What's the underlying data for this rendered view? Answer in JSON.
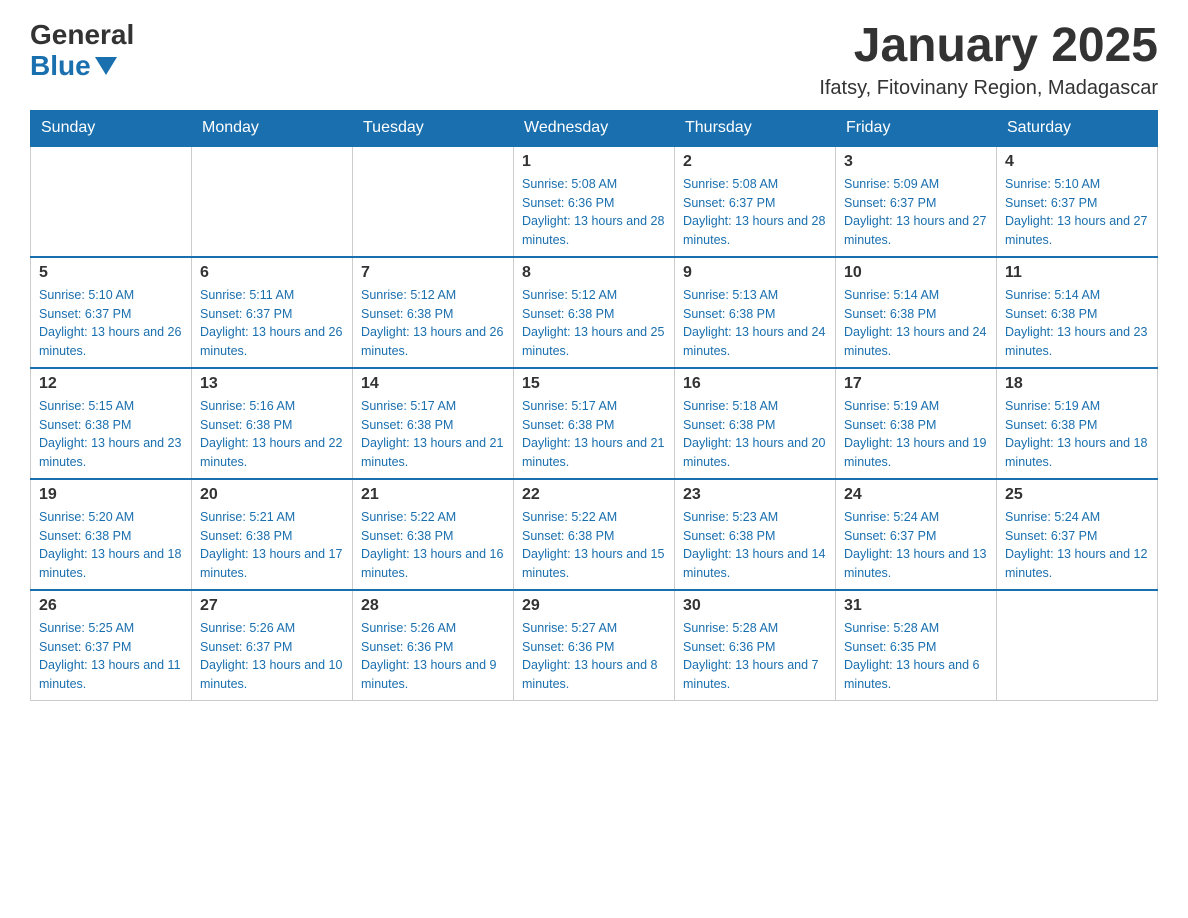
{
  "header": {
    "logo": {
      "text1": "General",
      "text2": "Blue"
    },
    "title": "January 2025",
    "subtitle": "Ifatsy, Fitovinany Region, Madagascar"
  },
  "days_of_week": [
    "Sunday",
    "Monday",
    "Tuesday",
    "Wednesday",
    "Thursday",
    "Friday",
    "Saturday"
  ],
  "weeks": [
    [
      {
        "day": "",
        "info": ""
      },
      {
        "day": "",
        "info": ""
      },
      {
        "day": "",
        "info": ""
      },
      {
        "day": "1",
        "info": "Sunrise: 5:08 AM\nSunset: 6:36 PM\nDaylight: 13 hours and 28 minutes."
      },
      {
        "day": "2",
        "info": "Sunrise: 5:08 AM\nSunset: 6:37 PM\nDaylight: 13 hours and 28 minutes."
      },
      {
        "day": "3",
        "info": "Sunrise: 5:09 AM\nSunset: 6:37 PM\nDaylight: 13 hours and 27 minutes."
      },
      {
        "day": "4",
        "info": "Sunrise: 5:10 AM\nSunset: 6:37 PM\nDaylight: 13 hours and 27 minutes."
      }
    ],
    [
      {
        "day": "5",
        "info": "Sunrise: 5:10 AM\nSunset: 6:37 PM\nDaylight: 13 hours and 26 minutes."
      },
      {
        "day": "6",
        "info": "Sunrise: 5:11 AM\nSunset: 6:37 PM\nDaylight: 13 hours and 26 minutes."
      },
      {
        "day": "7",
        "info": "Sunrise: 5:12 AM\nSunset: 6:38 PM\nDaylight: 13 hours and 26 minutes."
      },
      {
        "day": "8",
        "info": "Sunrise: 5:12 AM\nSunset: 6:38 PM\nDaylight: 13 hours and 25 minutes."
      },
      {
        "day": "9",
        "info": "Sunrise: 5:13 AM\nSunset: 6:38 PM\nDaylight: 13 hours and 24 minutes."
      },
      {
        "day": "10",
        "info": "Sunrise: 5:14 AM\nSunset: 6:38 PM\nDaylight: 13 hours and 24 minutes."
      },
      {
        "day": "11",
        "info": "Sunrise: 5:14 AM\nSunset: 6:38 PM\nDaylight: 13 hours and 23 minutes."
      }
    ],
    [
      {
        "day": "12",
        "info": "Sunrise: 5:15 AM\nSunset: 6:38 PM\nDaylight: 13 hours and 23 minutes."
      },
      {
        "day": "13",
        "info": "Sunrise: 5:16 AM\nSunset: 6:38 PM\nDaylight: 13 hours and 22 minutes."
      },
      {
        "day": "14",
        "info": "Sunrise: 5:17 AM\nSunset: 6:38 PM\nDaylight: 13 hours and 21 minutes."
      },
      {
        "day": "15",
        "info": "Sunrise: 5:17 AM\nSunset: 6:38 PM\nDaylight: 13 hours and 21 minutes."
      },
      {
        "day": "16",
        "info": "Sunrise: 5:18 AM\nSunset: 6:38 PM\nDaylight: 13 hours and 20 minutes."
      },
      {
        "day": "17",
        "info": "Sunrise: 5:19 AM\nSunset: 6:38 PM\nDaylight: 13 hours and 19 minutes."
      },
      {
        "day": "18",
        "info": "Sunrise: 5:19 AM\nSunset: 6:38 PM\nDaylight: 13 hours and 18 minutes."
      }
    ],
    [
      {
        "day": "19",
        "info": "Sunrise: 5:20 AM\nSunset: 6:38 PM\nDaylight: 13 hours and 18 minutes."
      },
      {
        "day": "20",
        "info": "Sunrise: 5:21 AM\nSunset: 6:38 PM\nDaylight: 13 hours and 17 minutes."
      },
      {
        "day": "21",
        "info": "Sunrise: 5:22 AM\nSunset: 6:38 PM\nDaylight: 13 hours and 16 minutes."
      },
      {
        "day": "22",
        "info": "Sunrise: 5:22 AM\nSunset: 6:38 PM\nDaylight: 13 hours and 15 minutes."
      },
      {
        "day": "23",
        "info": "Sunrise: 5:23 AM\nSunset: 6:38 PM\nDaylight: 13 hours and 14 minutes."
      },
      {
        "day": "24",
        "info": "Sunrise: 5:24 AM\nSunset: 6:37 PM\nDaylight: 13 hours and 13 minutes."
      },
      {
        "day": "25",
        "info": "Sunrise: 5:24 AM\nSunset: 6:37 PM\nDaylight: 13 hours and 12 minutes."
      }
    ],
    [
      {
        "day": "26",
        "info": "Sunrise: 5:25 AM\nSunset: 6:37 PM\nDaylight: 13 hours and 11 minutes."
      },
      {
        "day": "27",
        "info": "Sunrise: 5:26 AM\nSunset: 6:37 PM\nDaylight: 13 hours and 10 minutes."
      },
      {
        "day": "28",
        "info": "Sunrise: 5:26 AM\nSunset: 6:36 PM\nDaylight: 13 hours and 9 minutes."
      },
      {
        "day": "29",
        "info": "Sunrise: 5:27 AM\nSunset: 6:36 PM\nDaylight: 13 hours and 8 minutes."
      },
      {
        "day": "30",
        "info": "Sunrise: 5:28 AM\nSunset: 6:36 PM\nDaylight: 13 hours and 7 minutes."
      },
      {
        "day": "31",
        "info": "Sunrise: 5:28 AM\nSunset: 6:35 PM\nDaylight: 13 hours and 6 minutes."
      },
      {
        "day": "",
        "info": ""
      }
    ]
  ]
}
